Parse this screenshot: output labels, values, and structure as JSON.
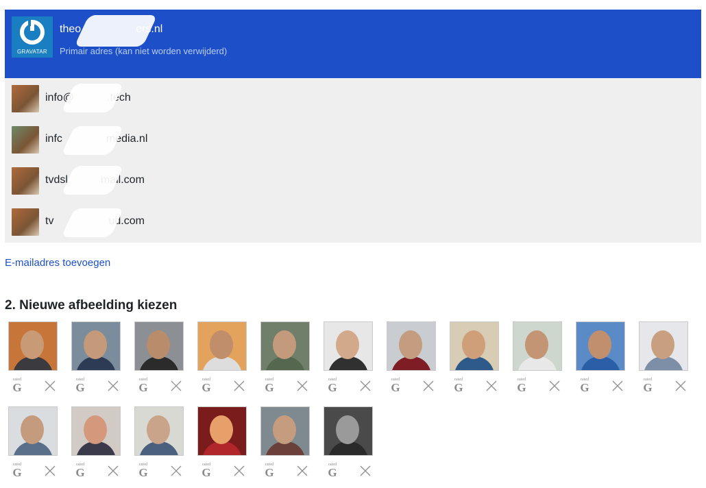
{
  "emails": {
    "primary": {
      "address": "theo     ers.nl",
      "note": "Primair adres (kan niet worden verwijderd)",
      "logo_text": "GRAVATAR",
      "icon": "gravatar-logo"
    },
    "secondary": [
      {
        "address": "info@   .tech",
        "thumb_color": "#b06a3c",
        "icon": "avatar-thumbnail"
      },
      {
        "address": "infc    media.nl",
        "thumb_color": "#6d8a6a",
        "icon": "avatar-thumbnail"
      },
      {
        "address": "tvdsl   mail.com",
        "thumb_color": "#b06a3c",
        "icon": "avatar-thumbnail"
      },
      {
        "address": "tv     ud.com",
        "thumb_color": "#b06a3c",
        "icon": "avatar-thumbnail"
      }
    ]
  },
  "add_email_label": "E-mailadres toevoegen",
  "section_title": "2. Nieuwe afbeelding kiezen",
  "rating": {
    "small": "rated",
    "letter": "G"
  },
  "images": [
    {
      "bg": "#c8753a",
      "skin": "#c99a76",
      "shirt": "#3b3a3f"
    },
    {
      "bg": "#7b8c9c",
      "skin": "#c49a7a",
      "shirt": "#2d3b55"
    },
    {
      "bg": "#8c8f94",
      "skin": "#b98c6c",
      "shirt": "#2b2b2b"
    },
    {
      "bg": "#e4a35c",
      "skin": "#c08e6a",
      "shirt": "#dddddd"
    },
    {
      "bg": "#6f7f6a",
      "skin": "#c39a7c",
      "shirt": "#55674f"
    },
    {
      "bg": "#e7e7e7",
      "skin": "#d3a98c",
      "shirt": "#303030"
    },
    {
      "bg": "#c9ccd1",
      "skin": "#c49c80",
      "shirt": "#7e1e24"
    },
    {
      "bg": "#d8ccb4",
      "skin": "#cf9f7a",
      "shirt": "#2e5a8a"
    },
    {
      "bg": "#cdd7cd",
      "skin": "#c39575",
      "shirt": "#e8e8e8"
    },
    {
      "bg": "#5b8bc6",
      "skin": "#c18f6e",
      "shirt": "#2a5fa8"
    },
    {
      "bg": "#e5e7ea",
      "skin": "#c9a07f",
      "shirt": "#7d8fa6"
    },
    {
      "bg": "#dadde0",
      "skin": "#c49b7c",
      "shirt": "#5a6f8a"
    },
    {
      "bg": "#d2cac5",
      "skin": "#d4997c",
      "shirt": "#3a3a4a"
    },
    {
      "bg": "#d9d9d4",
      "skin": "#c9a48a",
      "shirt": "#4b5f7e"
    },
    {
      "bg": "#7a1c1c",
      "skin": "#e8a06a",
      "shirt": "#b0262a"
    },
    {
      "bg": "#7e8a90",
      "skin": "#c59c7e",
      "shirt": "#6b3f3a"
    },
    {
      "bg": "#4a4a4a",
      "skin": "#9a9a9a",
      "shirt": "#2a2a2a"
    }
  ],
  "colors": {
    "primary_bg": "#1d4fc9",
    "secondary_bg": "#efefef",
    "link": "#1d4fc9"
  }
}
